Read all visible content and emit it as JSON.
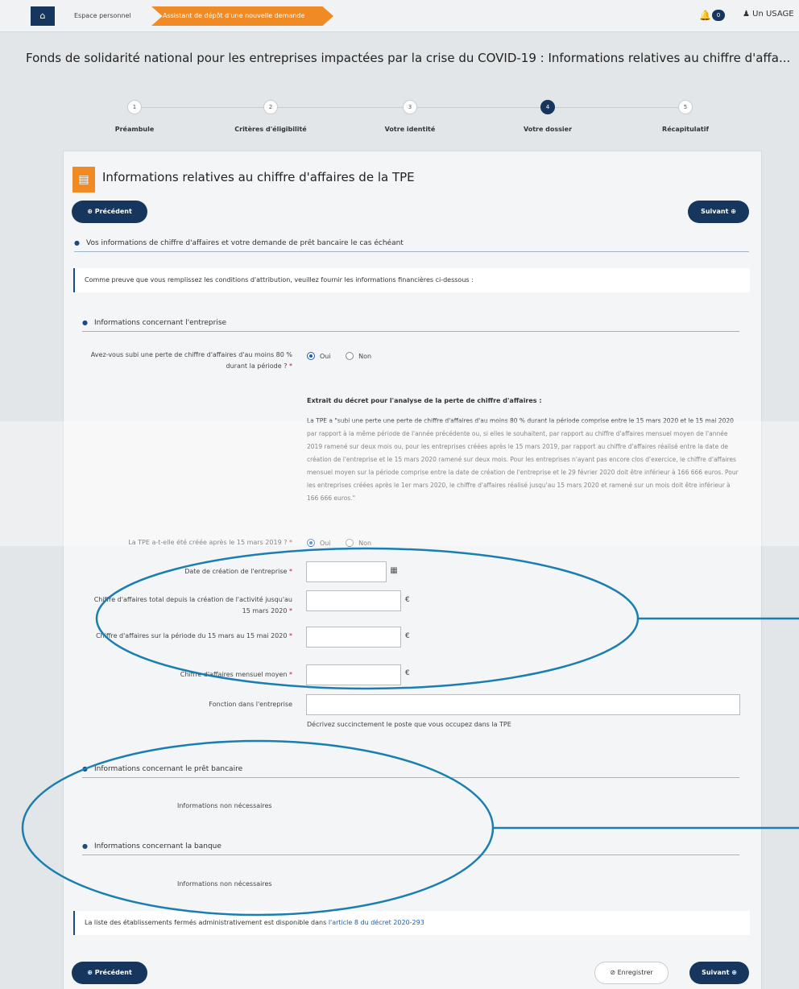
{
  "topbar": {
    "breadcrumb_home": "⌂",
    "breadcrumb_1": "Espace personnel",
    "breadcrumb_2": "Assistant de dépôt d'une nouvelle demande",
    "notif_count": "0",
    "user_label": "Un USAGE"
  },
  "page_title": "Fonds de solidarité national pour les entreprises impactées par la crise du COVID-19 : Informations relatives au chiffre d'affa...",
  "steps": [
    {
      "num": "1",
      "label": "Préambule"
    },
    {
      "num": "2",
      "label": "Critères d'éligibilité"
    },
    {
      "num": "3",
      "label": "Votre identité"
    },
    {
      "num": "4",
      "label": "Votre dossier"
    },
    {
      "num": "5",
      "label": "Récapitulatif"
    }
  ],
  "card": {
    "title": "Informations relatives au chiffre d'affaires de la TPE",
    "prev_label": "⊕ Précédent",
    "next_label": "Suivant ⊕",
    "save_label": "⊘ Enregistrer"
  },
  "section_main": "Vos informations de chiffre d'affaires et votre demande de prêt bancaire le cas échéant",
  "info_text": "Comme preuve que vous remplissez les conditions d'attribution, veuillez fournir les informations financières ci-dessous :",
  "section_company": "Informations concernant l'entreprise",
  "q_loss": "Avez-vous subi une perte de chiffre d'affaires d'au moins 80 % durant la période ?",
  "q_created": "La TPE a-t-elle été créée après le 15 mars 2019 ?",
  "radio_yes": "Oui",
  "radio_no": "Non",
  "extract_title": "Extrait du décret pour l'analyse de la perte de chiffre d'affaires :",
  "extract_body": "La TPE a \"subi une perte une perte de chiffre d'affaires d'au moins 80 % durant la période comprise entre le 15 mars 2020 et le 15 mai 2020 par rapport à la même période de l'année précédente ou, si elles le souhaitent, par rapport au chiffre d'affaires mensuel moyen de l'année 2019 ramené sur deux mois ou, pour les entreprises créées après le 15 mars 2019, par rapport au chiffre d'affaires réalisé entre la date de création de l'entreprise et le 15 mars 2020 ramené sur deux mois. Pour les entreprises n'ayant pas encore clos d'exercice, le chiffre d'affaires mensuel moyen sur la période comprise entre la date de création de l'entreprise et le 29 février 2020 doit être inférieur à 166 666 euros. Pour les entreprises créées après le 1er mars 2020, le chiffre d'affaires réalisé jusqu'au 15 mars 2020 et ramené sur un mois doit être inférieur à 166 666 euros.\"",
  "fields": {
    "creation_date": "Date de création de l'entreprise",
    "ca_total": "Chiffre d'affaires total depuis la création de l'activité jusqu'au 15 mars 2020",
    "ca_period": "Chiffre d'affaires sur la période du 15 mars au 15 mai 2020",
    "ca_monthly": "Chiffre d'affaires mensuel moyen",
    "function": "Fonction dans l'entreprise",
    "function_help": "Décrivez succinctement le poste que vous occupez dans la TPE",
    "euro": "€",
    "required": "*"
  },
  "section_loan": "Informations concernant le prêt bancaire",
  "section_bank": "Informations concernant la banque",
  "not_needed": "Informations non nécessaires",
  "footer_note": "La liste des établissements fermés administrativement est disponible dans ",
  "footer_link": "l'article 8 du décret 2020-293"
}
